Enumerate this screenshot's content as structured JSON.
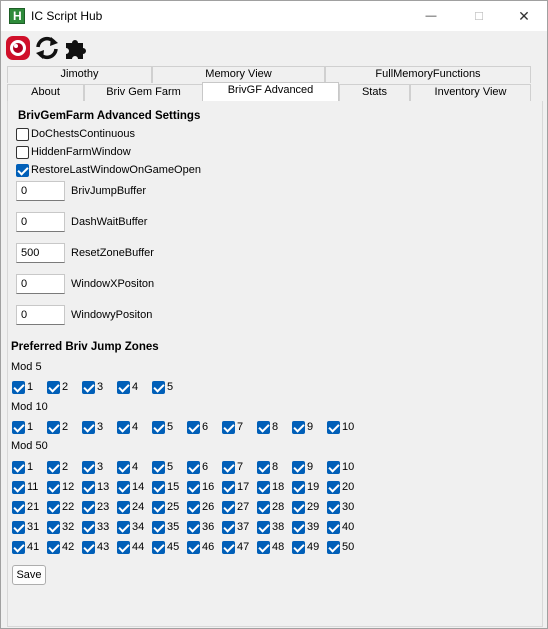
{
  "window": {
    "title": "IC Script Hub",
    "app_icon_letter": "H",
    "minimize": "—",
    "maximize": "☐",
    "close": "✕"
  },
  "tabs_row1": [
    {
      "label": "Jimothy"
    },
    {
      "label": "Memory View"
    },
    {
      "label": "FullMemoryFunctions"
    }
  ],
  "tabs_row2": [
    {
      "label": "About"
    },
    {
      "label": "Briv Gem Farm"
    },
    {
      "label": "BrivGF Advanced",
      "active": true
    },
    {
      "label": "Stats"
    },
    {
      "label": "Inventory View"
    }
  ],
  "settings": {
    "title": "BrivGemFarm Advanced Settings",
    "options": [
      {
        "label": "DoChestsContinuous",
        "checked": false
      },
      {
        "label": "HiddenFarmWindow",
        "checked": false
      },
      {
        "label": "RestoreLastWindowOnGameOpen",
        "checked": true
      }
    ],
    "fields": [
      {
        "value": "0",
        "label": "BrivJumpBuffer"
      },
      {
        "value": "0",
        "label": "DashWaitBuffer"
      },
      {
        "value": "500",
        "label": "ResetZoneBuffer"
      },
      {
        "value": "0",
        "label": "WindowXPositon"
      },
      {
        "value": "0",
        "label": "WindowyPositon"
      }
    ]
  },
  "zones": {
    "title": "Preferred Briv Jump Zones",
    "mod5_label": "Mod 5",
    "mod10_label": "Mod 10",
    "mod50_label": "Mod 50",
    "mod5": [
      "1",
      "2",
      "3",
      "4",
      "5"
    ],
    "mod10": [
      "1",
      "2",
      "3",
      "4",
      "5",
      "6",
      "7",
      "8",
      "9",
      "10"
    ],
    "mod50": [
      "1",
      "2",
      "3",
      "4",
      "5",
      "6",
      "7",
      "8",
      "9",
      "10",
      "11",
      "12",
      "13",
      "14",
      "15",
      "16",
      "17",
      "18",
      "19",
      "20",
      "21",
      "22",
      "23",
      "24",
      "25",
      "26",
      "27",
      "28",
      "29",
      "30",
      "31",
      "32",
      "33",
      "34",
      "35",
      "36",
      "37",
      "38",
      "39",
      "40",
      "41",
      "42",
      "43",
      "44",
      "45",
      "46",
      "47",
      "48",
      "49",
      "50"
    ]
  },
  "save_label": "Save",
  "colors": {
    "checkbox_accent": "#005fb8",
    "app_icon": "#2e8b3a"
  }
}
